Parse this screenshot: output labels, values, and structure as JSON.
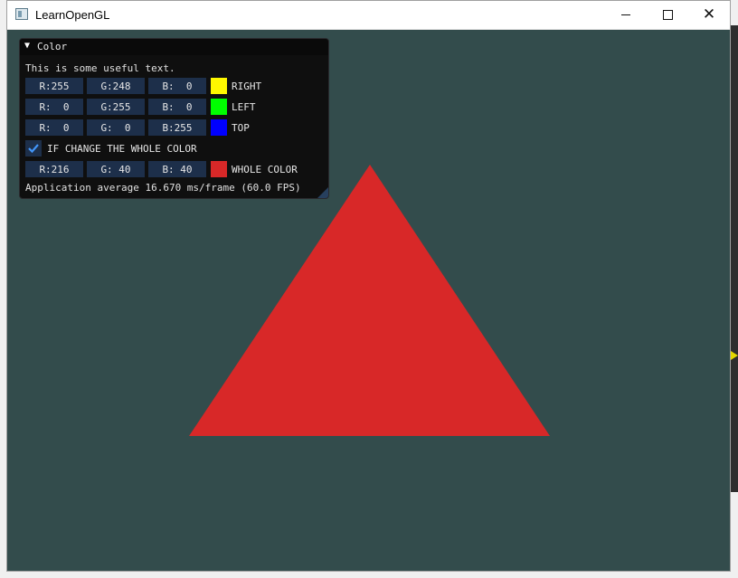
{
  "window": {
    "title": "LearnOpenGL",
    "icon": "window-app-icon"
  },
  "controls": {
    "minimize_icon": "minimize-icon",
    "maximize_icon": "maximize-icon",
    "close_icon": "close-icon",
    "close_glyph": "✕"
  },
  "panel": {
    "collapse_arrow": "▼",
    "title": "Color",
    "intro_text": "This is some useful text.",
    "rows": [
      {
        "r": "R:255",
        "g": "G:248",
        "b": "B:  0",
        "label": "RIGHT",
        "swatch": "#fff800"
      },
      {
        "r": "R:  0",
        "g": "G:255",
        "b": "B:  0",
        "label": "LEFT",
        "swatch": "#00ff00"
      },
      {
        "r": "R:  0",
        "g": "G:  0",
        "b": "B:255",
        "label": "TOP",
        "swatch": "#0000ff"
      }
    ],
    "checkbox": {
      "checked": true,
      "label": "IF CHANGE THE WHOLE COLOR"
    },
    "whole": {
      "r": "R:216",
      "g": "G: 40",
      "b": "B: 40",
      "label": "WHOLE COLOR",
      "swatch": "#d82828"
    },
    "fps_text": "Application average 16.670 ms/frame (60.0 FPS)"
  },
  "scene": {
    "clear_color": "#334c4c",
    "triangle_color": "#d82828"
  }
}
